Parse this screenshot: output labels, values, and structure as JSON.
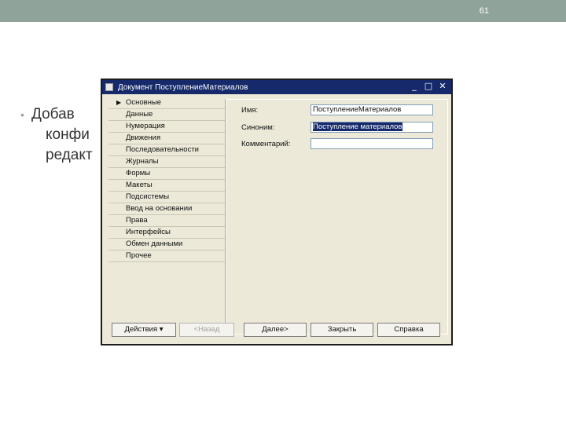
{
  "slide": {
    "number": "61",
    "bullet_lines": [
      "Добав",
      "конфи",
      "редакт"
    ]
  },
  "window": {
    "title": "Документ ПоступлениеМатериалов",
    "minimize": "_",
    "maximize": "□",
    "close": "✕"
  },
  "nav": {
    "items": [
      {
        "label": "Основные",
        "active": true
      },
      {
        "label": "Данные"
      },
      {
        "label": "Нумерация"
      },
      {
        "label": "Движения"
      },
      {
        "label": "Последовательности"
      },
      {
        "label": "Журналы"
      },
      {
        "label": "Формы"
      },
      {
        "label": "Макеты"
      },
      {
        "label": "Подсистемы"
      },
      {
        "label": "Ввод на основании"
      },
      {
        "label": "Права"
      },
      {
        "label": "Интерфейсы"
      },
      {
        "label": "Обмен данными"
      },
      {
        "label": "Прочее"
      }
    ]
  },
  "form": {
    "name_label": "Имя:",
    "name_value": "ПоступлениеМатериалов",
    "synonym_label": "Синоним:",
    "synonym_value": "Поступление материалов",
    "comment_label": "Комментарий:",
    "comment_value": ""
  },
  "buttons": {
    "actions": "Действия",
    "actions_arrow": "▾",
    "back": "<Назад",
    "next": "Далее>",
    "close": "Закрыть",
    "help": "Справка"
  },
  "colors": {
    "accent_bar": "#8fa39b",
    "titlebar": "#15296b",
    "window_bg": "#ece9d8"
  }
}
